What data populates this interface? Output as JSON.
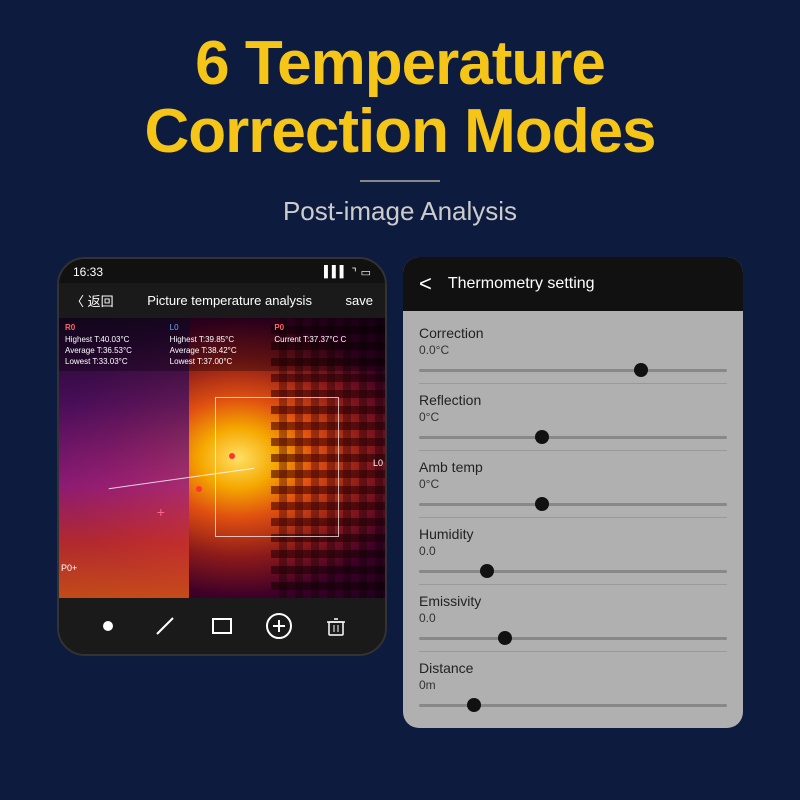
{
  "header": {
    "title_line1": "6 Temperature",
    "title_line2": "Correction Modes",
    "subtitle": "Post-image Analysis"
  },
  "phone_left": {
    "status_bar": {
      "time": "16:33",
      "signal": "▌▌▌",
      "wifi": "⌐",
      "battery": "▭"
    },
    "nav": {
      "back": "〈 返回",
      "title": "Picture temperature analysis",
      "save": "save"
    },
    "thermal_data": {
      "r0_label": "R0",
      "r0_highest": "Highest T:40.03°C",
      "r0_average": "Average T:36.53°C",
      "r0_lowest": "Lowest T:33.03°C",
      "l0_label": "L0",
      "l0_highest": "Highest T:39.85°C",
      "l0_average": "Average T:38.42°C",
      "l0_lowest": "Lowest T:37.00°C",
      "p0_label": "P0",
      "p0_current": "Current T:37.37°C C"
    },
    "toolbar": {
      "dot": "●",
      "slash": "/",
      "rect": "□",
      "plus_circle": "⊕",
      "trash": "🗑"
    }
  },
  "panel_right": {
    "header": {
      "back": "<",
      "title": "Thermometry setting"
    },
    "settings": [
      {
        "id": "correction",
        "label": "Correction",
        "value": "0.0°C",
        "thumb_pct": 72
      },
      {
        "id": "reflection",
        "label": "Reflection",
        "value": "0°C",
        "thumb_pct": 40
      },
      {
        "id": "amb_temp",
        "label": "Amb temp",
        "value": "0°C",
        "thumb_pct": 40
      },
      {
        "id": "humidity",
        "label": "Humidity",
        "value": "0.0",
        "thumb_pct": 22
      },
      {
        "id": "emissivity",
        "label": "Emissivity",
        "value": "0.0",
        "thumb_pct": 28
      },
      {
        "id": "distance",
        "label": "Distance",
        "value": "0m",
        "thumb_pct": 18
      }
    ]
  },
  "colors": {
    "background": "#0d1b3e",
    "title_yellow": "#f5c518",
    "subtitle_gray": "#cccccc"
  }
}
